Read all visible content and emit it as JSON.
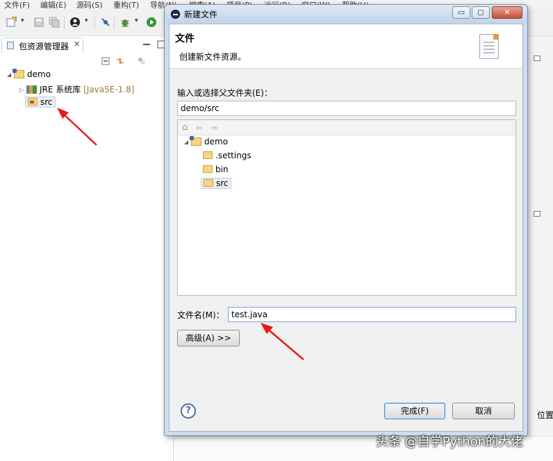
{
  "menubar": {
    "items": [
      "文件(F)",
      "编辑(E)",
      "源码(S)",
      "重构(T)",
      "导航(N)",
      "搜索(A)",
      "项目(P)",
      "运行(R)",
      "窗口(W)",
      "帮助(H)"
    ]
  },
  "explorer": {
    "tab_label": "包资源管理器",
    "tab_close": "✕",
    "tree": {
      "project": "demo",
      "jre_label": "JRE 系统库",
      "jre_version": "[JavaSE-1.8]",
      "src": "src"
    }
  },
  "dialog": {
    "window_title": "新建文件",
    "header_title": "文件",
    "header_desc": "创建新文件资源。",
    "parent_label": "输入或选择父文件夹(E)：",
    "parent_value": "demo/src",
    "tree": {
      "root": "demo",
      "children": [
        ".settings",
        "bin",
        "src"
      ]
    },
    "filename_label": "文件名(M)：",
    "filename_value": "test.java",
    "advanced_button": "高级(A) >>",
    "help_button": "?",
    "finish_button": "完成(F)",
    "cancel_button": "取消",
    "win_minimize": "▭",
    "win_maximize": "◻",
    "win_close": "✕"
  },
  "right_panel": {
    "position_label": "位置"
  },
  "watermark": "头条 @自学Python的大佬",
  "colors": {
    "arrow": "#e31b1b",
    "accent": "#4d8fd0"
  }
}
